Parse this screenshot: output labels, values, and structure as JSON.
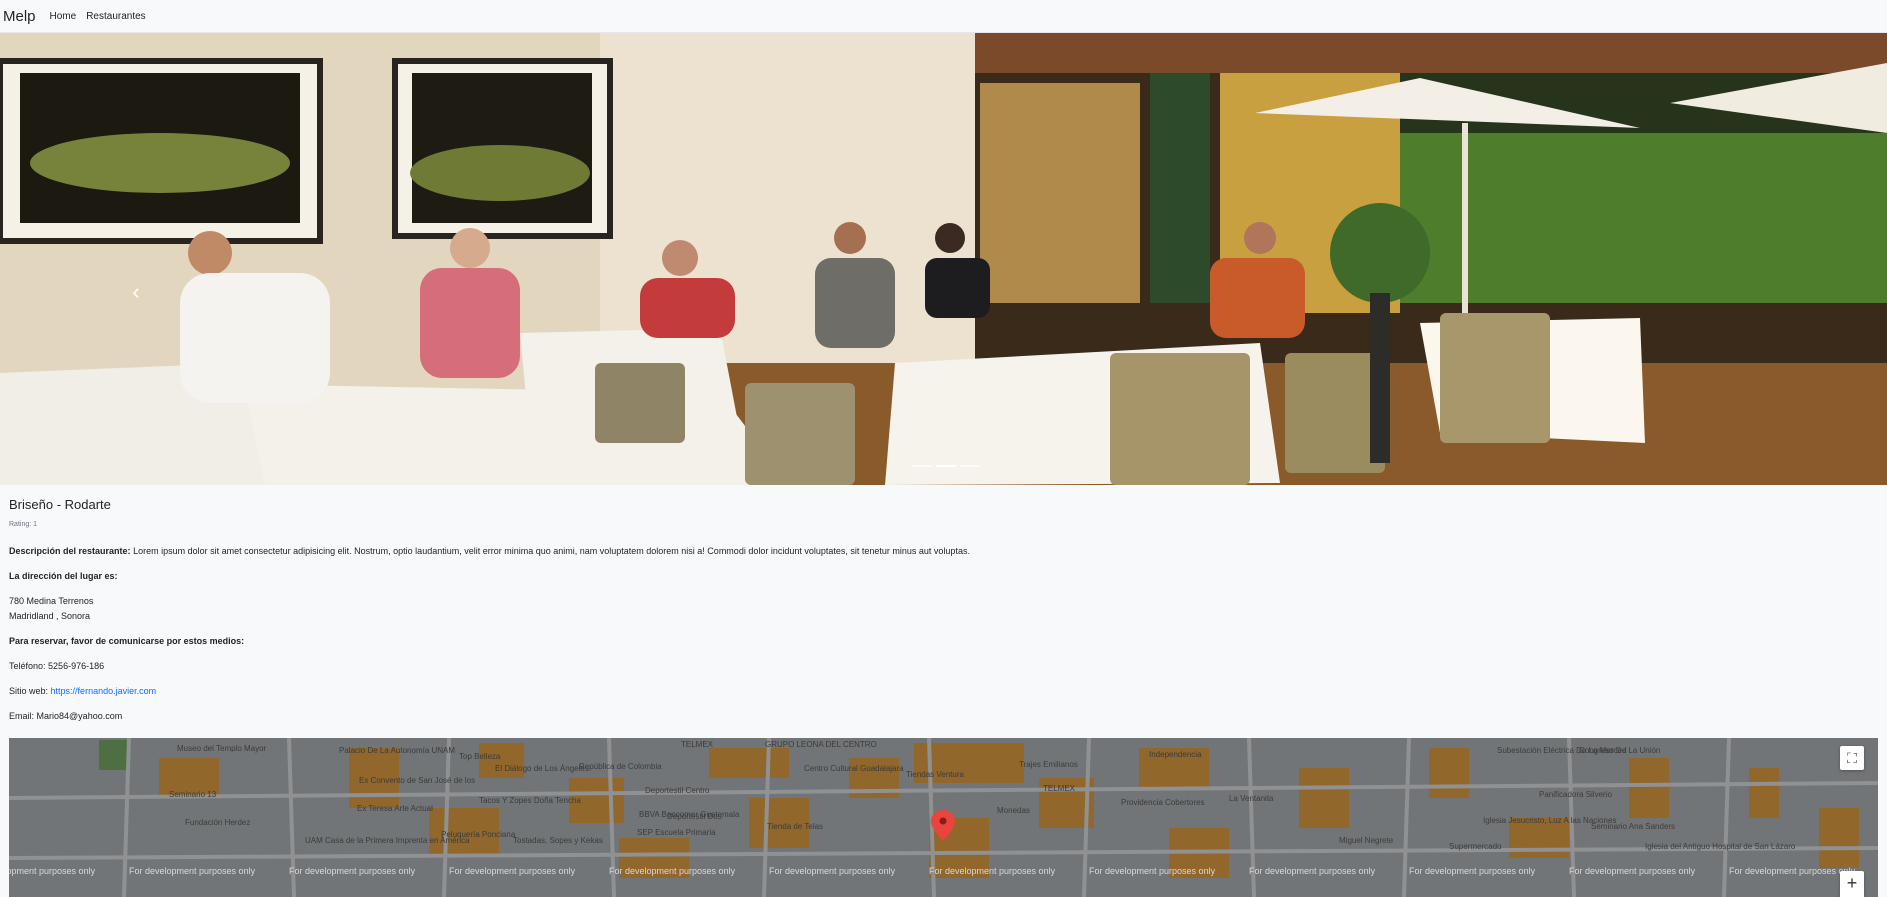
{
  "navbar": {
    "brand": "Melp",
    "links": [
      "Home",
      "Restaurantes"
    ]
  },
  "carousel": {
    "prev_icon": "chevron-left-icon",
    "active_index": 1,
    "indicator_count": 3
  },
  "restaurant": {
    "name": "Briseño - Rodarte",
    "rating": "Rating: 1",
    "description_label": "Descripción del restaurante:",
    "description": "Lorem ipsum dolor sit amet consectetur adipisicing elit. Nostrum, optio laudantium, velit error minima quo animi, nam voluptatem dolorem nisi a! Commodi dolor incidunt voluptates, sit tenetur minus aut voluptas.",
    "address_heading": "La dirección del lugar es:",
    "address_line1": "780 Medina Terrenos",
    "address_line2": "Madridland , Sonora",
    "reserve_heading": "Para reservar, favor de comunicarse por estos medios:",
    "phone_label": "Teléfono:",
    "phone": "5256-976-186",
    "web_label": "Sitio web:",
    "web_url": "https://fernando.javier.com",
    "email_label": "Email:",
    "email": "Mario84@yahoo.com"
  },
  "map": {
    "watermark": "For development purposes only",
    "fullscreen_icon": "fullscreen-icon",
    "zoom_in_label": "+",
    "pin_icon": "map-pin-icon",
    "labels": [
      "Museo del Templo Mayor",
      "Palacio De La Autonomía UNAM",
      "Top Belleza",
      "República de Colombia",
      "TELMEX",
      "GRUPO LEONA DEL CENTRO",
      "Trajes Emilianos",
      "Centro Cultural Guadalajara",
      "Tiendas Ventura",
      "TELMEX",
      "Independencia",
      "Subestación Eléctrica De La Merced",
      "Congreso De La Unión",
      "Seminario 13",
      "Ex Convento de San José de los",
      "El Diálogo de Los Ángeles",
      "Deportestil Centro",
      "Monedas",
      "Providencia Cobertores",
      "La Ventanita",
      "Panificadora Silverio",
      "Fundación Herdez",
      "Ex Teresa Arte Actual",
      "Tacos Y Zopes Doña Tencha",
      "BBVA Bancomer Guatemala",
      "Deportestil Dos",
      "Tienda de Telas",
      "Miguel Negrete",
      "Iglesia Jesucristo, Luz A las Naciones",
      "Seminario Ana Sanders",
      "UAM Casa de la Primera Imprenta en América",
      "Peluquería Ponciana",
      "SEP Escuela Primaria",
      "Tostadas, Sopes y Kekas",
      "Supermercado",
      "Iglesia del Antiguo Hospital de San Lázaro"
    ]
  }
}
